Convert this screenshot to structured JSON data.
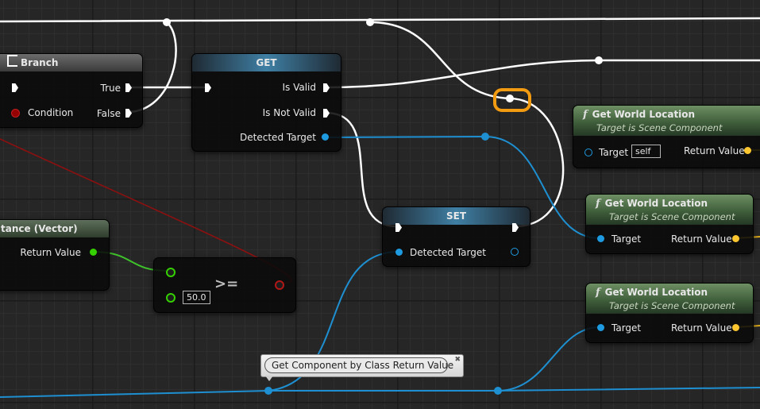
{
  "branch": {
    "title": "Branch",
    "true_label": "True",
    "false_label": "False",
    "condition_label": "Condition"
  },
  "get_node": {
    "title": "GET",
    "is_valid": "Is Valid",
    "is_not_valid": "Is Not Valid",
    "detected_target": "Detected Target"
  },
  "set_node": {
    "title": "SET",
    "detected_target": "Detected Target"
  },
  "distance_node": {
    "title": "tance (Vector)",
    "return_value": "Return Value"
  },
  "compare_node": {
    "operator": ">=",
    "value": "50.0"
  },
  "gwl_nodes": [
    {
      "title": "Get World Location",
      "subtitle": "Target is Scene Component",
      "target": "Target",
      "target_default": "self",
      "return_value": "Return Value"
    },
    {
      "title": "Get World Location",
      "subtitle": "Target is Scene Component",
      "target": "Target",
      "return_value": "Return Value"
    },
    {
      "title": "Get World Location",
      "subtitle": "Target is Scene Component",
      "target": "Target",
      "return_value": "Return Value"
    }
  ],
  "tooltip": {
    "text": "Get Component by Class Return Value"
  },
  "function_symbol": "f",
  "colors": {
    "exec": "#ffffff",
    "object": "#00a8f4",
    "bool": "#950000",
    "float": "#35d000",
    "vector": "#fec730",
    "reroute_highlight": "#f39c12"
  }
}
